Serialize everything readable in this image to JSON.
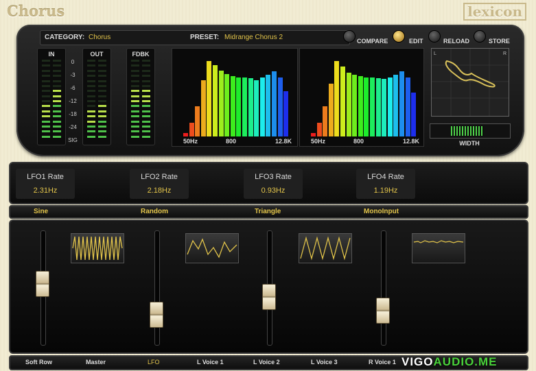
{
  "app": {
    "title": "Chorus",
    "brand": "lexicon"
  },
  "header": {
    "category_label": "CATEGORY:",
    "category": "Chorus",
    "preset_label": "PRESET:",
    "preset": "Midrange Chorus 2",
    "buttons": [
      "COMPARE",
      "EDIT",
      "RELOAD",
      "STORE"
    ]
  },
  "meters": {
    "in_label": "IN",
    "out_label": "OUT",
    "fdbk_label": "FDBK",
    "scale": [
      "0",
      "-3",
      "-6",
      "-12",
      "-18",
      "-24",
      "SIG"
    ],
    "in_levels": [
      0.45,
      0.62
    ],
    "out_levels": [
      0.38,
      0.42
    ],
    "fdbk_levels": [
      0.62,
      0.62
    ]
  },
  "spectrum": {
    "left_labels": [
      "50Hz",
      "800",
      "12.8K"
    ],
    "right_labels": [
      "50Hz",
      "800",
      "12.8K"
    ],
    "left": [
      0.05,
      0.18,
      0.4,
      0.75,
      1.0,
      0.95,
      0.87,
      0.83,
      0.8,
      0.78,
      0.78,
      0.77,
      0.75,
      0.78,
      0.82,
      0.86,
      0.78,
      0.6
    ],
    "right": [
      0.05,
      0.18,
      0.4,
      0.7,
      1.0,
      0.93,
      0.85,
      0.82,
      0.8,
      0.78,
      0.78,
      0.77,
      0.76,
      0.78,
      0.82,
      0.86,
      0.78,
      0.58
    ]
  },
  "scope": {
    "corner_l": "L",
    "corner_r": "R",
    "width_label": "WIDTH"
  },
  "lfos": [
    {
      "name": "LFO1 Rate",
      "value": "2.31Hz"
    },
    {
      "name": "LFO2 Rate",
      "value": "2.18Hz"
    },
    {
      "name": "LFO3 Rate",
      "value": "0.93Hz"
    },
    {
      "name": "LFO4 Rate",
      "value": "1.19Hz"
    }
  ],
  "waveforms": [
    "Sine",
    "Random",
    "Triangle",
    "MonoInput"
  ],
  "faders": [
    0.55,
    0.2,
    0.4,
    0.25
  ],
  "footer": {
    "tabs": [
      "Soft Row",
      "Master",
      "LFO",
      "L Voice 1",
      "L Voice 2",
      "L Voice 3",
      "R Voice 1"
    ],
    "active": "LFO"
  },
  "watermark": {
    "a": "VIGO",
    "b": "AUDIO.ME"
  },
  "colors": {
    "accent": "#e2c44a",
    "panel": "#111111",
    "background": "#f1ecd3"
  }
}
